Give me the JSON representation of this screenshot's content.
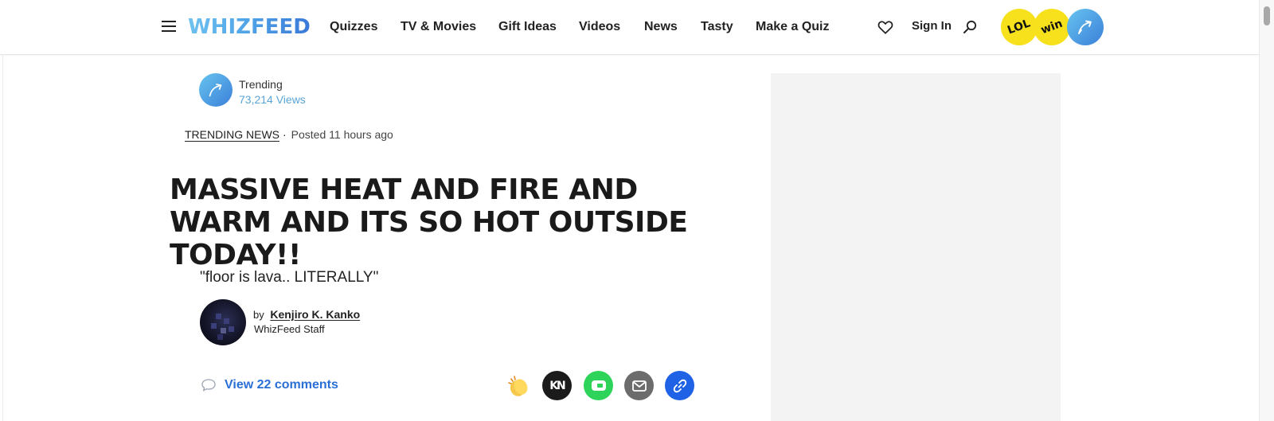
{
  "header": {
    "menu_icon": "hamburger-icon",
    "logo": "WHIZFEED",
    "nav": [
      "Quizzes",
      "TV & Movies",
      "Gift Ideas",
      "Videos",
      "News",
      "Tasty",
      "Make a Quiz"
    ],
    "favorites_icon": "heart-icon",
    "signin_label": "Sign In",
    "search_icon": "search-icon",
    "badges": [
      "LOL",
      "win"
    ],
    "trending_badge_icon": "trending-arrow-icon"
  },
  "article": {
    "trending_label": "Trending",
    "views": "73,214 Views",
    "category": "TRENDING NEWS",
    "posted": "Posted 11 hours ago",
    "headline": "MASSIVE HEAT AND FIRE AND WARM AND ITS SO HOT OUTSIDE TODAY!!",
    "subtitle": "\"floor is lava.. LITERALLY\"",
    "by_prefix": "by",
    "author": "Kenjiro K. Kanko",
    "author_role": "WhizFeed Staff",
    "comments_label": "View 22 comments",
    "share_kn_label": "KN"
  },
  "colors": {
    "accent_blue": "#2a6fd6",
    "badge_yellow": "#f7e11c",
    "views_blue": "#5aa5d6"
  }
}
